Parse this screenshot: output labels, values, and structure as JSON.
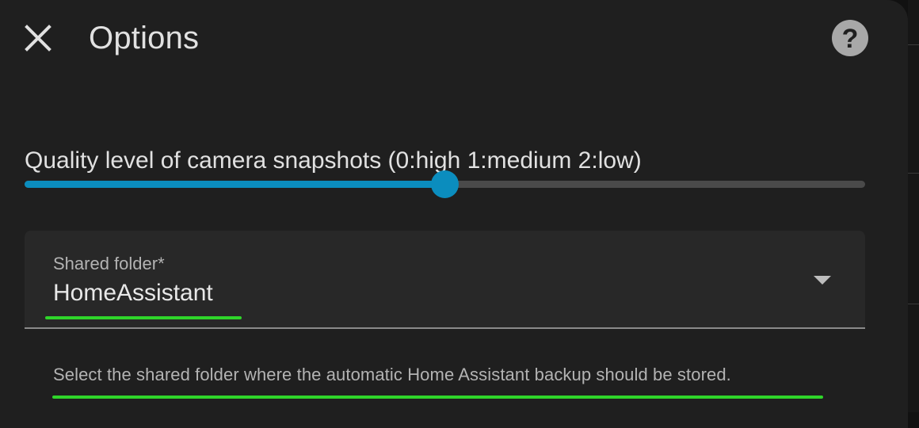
{
  "dialog": {
    "title": "Options",
    "close_icon": "close-icon",
    "help_icon": "help-icon",
    "help_glyph": "?"
  },
  "slider": {
    "label": "Quality level of camera snapshots (0:high 1:medium 2:low)",
    "min": 0,
    "max": 2,
    "value": 1,
    "accent_color": "#0b8dbe"
  },
  "shared_folder": {
    "label": "Shared folder*",
    "value": "HomeAssistant",
    "arrow_icon": "dropdown-arrow-icon",
    "helper": "Select the shared folder where the automatic Home Assistant backup should be stored."
  },
  "highlight_color": "#2fd52a"
}
